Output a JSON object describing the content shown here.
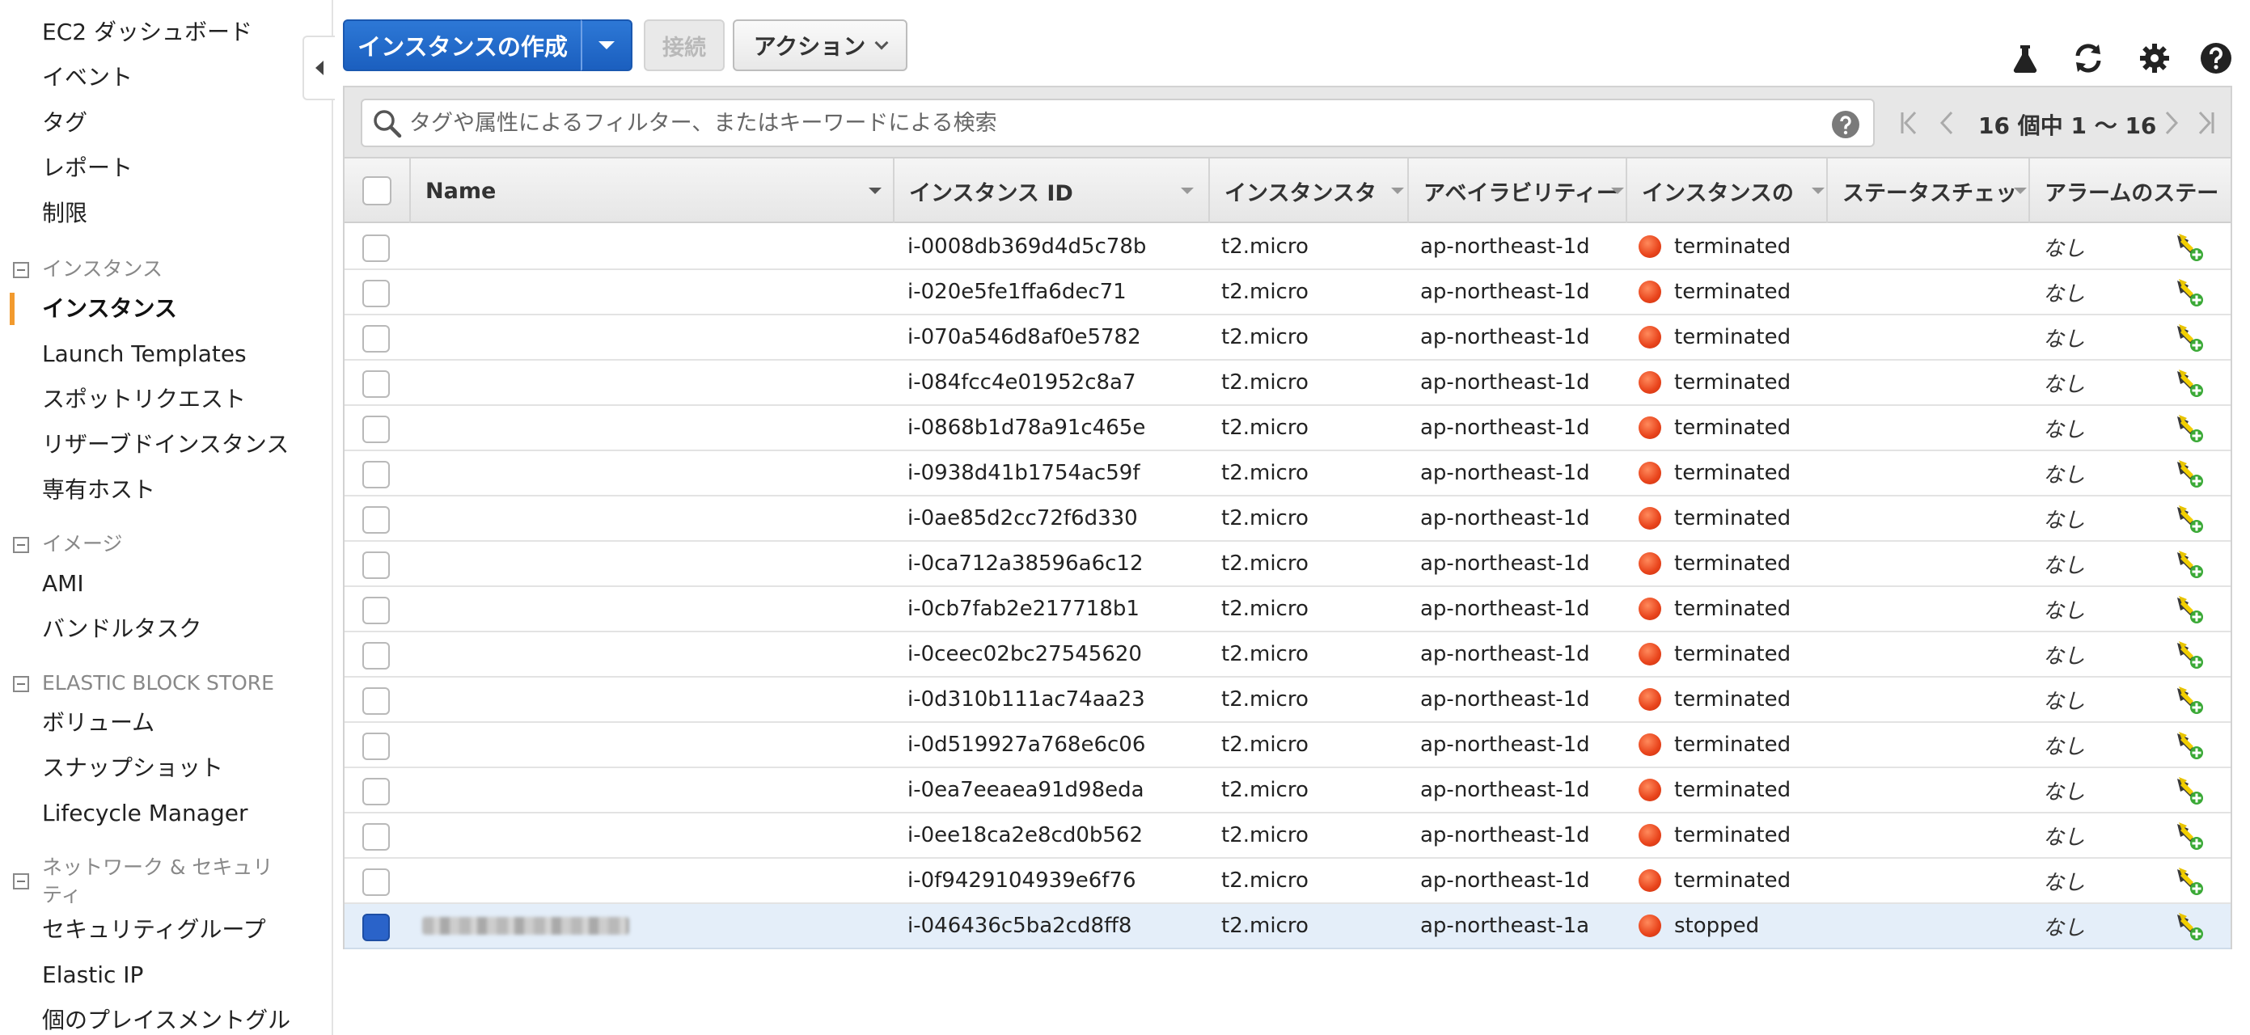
{
  "sidebar": {
    "top_links": [
      "EC2 ダッシュボード",
      "イベント",
      "タグ",
      "レポート",
      "制限"
    ],
    "sections": [
      {
        "title": "インスタンス",
        "items": [
          "インスタンス",
          "Launch Templates",
          "スポットリクエスト",
          "リザーブドインスタンス",
          "専有ホスト"
        ],
        "active_index": 0
      },
      {
        "title": "イメージ",
        "items": [
          "AMI",
          "バンドルタスク"
        ]
      },
      {
        "title": "ELASTIC BLOCK STORE",
        "items": [
          "ボリューム",
          "スナップショット",
          "Lifecycle Manager"
        ]
      },
      {
        "title": "ネットワーク & セキュリティ",
        "items": [
          "セキュリティグループ",
          "Elastic IP",
          "個のプレイスメントグル"
        ]
      }
    ]
  },
  "toolbar": {
    "create_label": "インスタンスの作成",
    "connect_label": "接続",
    "actions_label": "アクション",
    "icons": [
      "flask-icon",
      "refresh-icon",
      "gear-icon",
      "help-icon"
    ]
  },
  "search": {
    "placeholder": "タグや属性によるフィルター、またはキーワードによる検索",
    "pager_text": "16 個中 1 〜 16"
  },
  "table": {
    "columns": [
      "Name",
      "インスタンス ID",
      "インスタンスタ",
      "アベイラビリティー",
      "インスタンスの",
      "ステータスチェッ",
      "アラームのステー"
    ],
    "rows": [
      {
        "name": "",
        "id": "i-0008db369d4d5c78b",
        "type": "t2.micro",
        "zone": "ap-northeast-1d",
        "state": "terminated",
        "alarm": "なし",
        "selected": false
      },
      {
        "name": "",
        "id": "i-020e5fe1ffa6dec71",
        "type": "t2.micro",
        "zone": "ap-northeast-1d",
        "state": "terminated",
        "alarm": "なし",
        "selected": false
      },
      {
        "name": "",
        "id": "i-070a546d8af0e5782",
        "type": "t2.micro",
        "zone": "ap-northeast-1d",
        "state": "terminated",
        "alarm": "なし",
        "selected": false
      },
      {
        "name": "",
        "id": "i-084fcc4e01952c8a7",
        "type": "t2.micro",
        "zone": "ap-northeast-1d",
        "state": "terminated",
        "alarm": "なし",
        "selected": false
      },
      {
        "name": "",
        "id": "i-0868b1d78a91c465e",
        "type": "t2.micro",
        "zone": "ap-northeast-1d",
        "state": "terminated",
        "alarm": "なし",
        "selected": false
      },
      {
        "name": "",
        "id": "i-0938d41b1754ac59f",
        "type": "t2.micro",
        "zone": "ap-northeast-1d",
        "state": "terminated",
        "alarm": "なし",
        "selected": false
      },
      {
        "name": "",
        "id": "i-0ae85d2cc72f6d330",
        "type": "t2.micro",
        "zone": "ap-northeast-1d",
        "state": "terminated",
        "alarm": "なし",
        "selected": false
      },
      {
        "name": "",
        "id": "i-0ca712a38596a6c12",
        "type": "t2.micro",
        "zone": "ap-northeast-1d",
        "state": "terminated",
        "alarm": "なし",
        "selected": false
      },
      {
        "name": "",
        "id": "i-0cb7fab2e217718b1",
        "type": "t2.micro",
        "zone": "ap-northeast-1d",
        "state": "terminated",
        "alarm": "なし",
        "selected": false
      },
      {
        "name": "",
        "id": "i-0ceec02bc27545620",
        "type": "t2.micro",
        "zone": "ap-northeast-1d",
        "state": "terminated",
        "alarm": "なし",
        "selected": false
      },
      {
        "name": "",
        "id": "i-0d310b111ac74aa23",
        "type": "t2.micro",
        "zone": "ap-northeast-1d",
        "state": "terminated",
        "alarm": "なし",
        "selected": false
      },
      {
        "name": "",
        "id": "i-0d519927a768e6c06",
        "type": "t2.micro",
        "zone": "ap-northeast-1d",
        "state": "terminated",
        "alarm": "なし",
        "selected": false
      },
      {
        "name": "",
        "id": "i-0ea7eeaea91d98eda",
        "type": "t2.micro",
        "zone": "ap-northeast-1d",
        "state": "terminated",
        "alarm": "なし",
        "selected": false
      },
      {
        "name": "",
        "id": "i-0ee18ca2e8cd0b562",
        "type": "t2.micro",
        "zone": "ap-northeast-1d",
        "state": "terminated",
        "alarm": "なし",
        "selected": false
      },
      {
        "name": "",
        "id": "i-0f9429104939e6f76",
        "type": "t2.micro",
        "zone": "ap-northeast-1d",
        "state": "terminated",
        "alarm": "なし",
        "selected": false
      },
      {
        "name": "",
        "id": "i-046436c5ba2cd8ff8",
        "type": "t2.micro",
        "zone": "ap-northeast-1a",
        "state": "stopped",
        "alarm": "なし",
        "selected": true,
        "name_blurred": true
      }
    ]
  },
  "colors": {
    "primary_button": "#1b5fbf",
    "active_nav_bar": "#f29a2e",
    "status_dot": "#e8431b",
    "selected_row": "#e4eef9"
  }
}
